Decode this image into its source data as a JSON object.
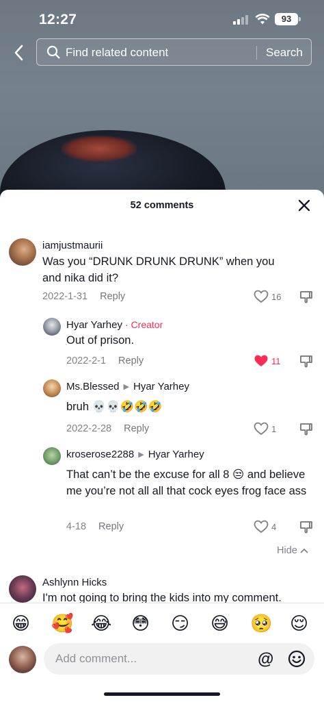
{
  "status_bar": {
    "time": "12:27",
    "battery": "93"
  },
  "search": {
    "placeholder": "Find related content",
    "button_label": "Search"
  },
  "sheet": {
    "title": "52 comments"
  },
  "comments": [
    {
      "user": "iamjustmaurii",
      "text": "Was you “DRUNK DRUNK DRUNK” when you and nika did it?",
      "date": "2022-1-31",
      "reply": "Reply",
      "likes": "16",
      "liked": false
    },
    {
      "user": "Hyar Yarhey",
      "badge": "Creator",
      "text": "Out of prison.",
      "date": "2022-2-1",
      "reply": "Reply",
      "likes": "11",
      "liked": true
    },
    {
      "user": "Ms.Blessed",
      "reply_to": "Hyar Yarhey",
      "text": "bruh 💀💀🤣🤣🤣",
      "date": "2022-2-28",
      "reply": "Reply",
      "likes": "1",
      "liked": false
    },
    {
      "user": "kroserose2288",
      "reply_to": "Hyar Yarhey",
      "text": "That can’t be the excuse for all 8 😒 and believe me you’re not all all that cock eyes frog face ass",
      "date": "4-18",
      "reply": "Reply",
      "likes": "4",
      "liked": false
    },
    {
      "user": "Ashlynn Hicks",
      "text": "I'm not going to bring the kids into my comment."
    }
  ],
  "hide_label": "Hide",
  "emoji_bar": [
    "😁",
    "🥰",
    "😂",
    "😳",
    "😏",
    "😅",
    "🥺",
    "😌"
  ],
  "comment_input": {
    "placeholder": "Add comment...",
    "at_symbol": "@"
  },
  "colors": {
    "accent_red": "#fe2c55",
    "text": "#161823"
  }
}
